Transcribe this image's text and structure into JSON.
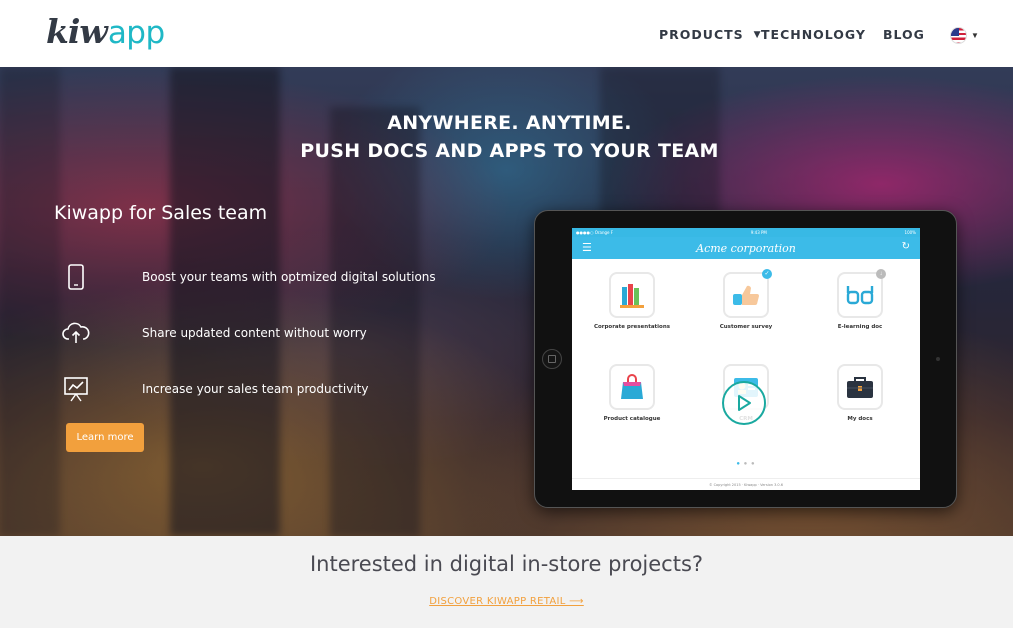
{
  "header": {
    "logo_part1": "kiw",
    "logo_part2": "app",
    "nav": {
      "products": "PRODUCTS",
      "technology": "TECHNOLOGY",
      "blog": "BLOG"
    },
    "language_icon": "us-flag-icon"
  },
  "hero": {
    "title_line1": "ANYWHERE. ANYTIME.",
    "title_line2": "PUSH DOCS AND APPS TO YOUR TEAM",
    "section_heading": "Kiwapp for Sales team",
    "features": [
      {
        "icon": "smartphone-icon",
        "text": "Boost your teams with optmized digital solutions"
      },
      {
        "icon": "cloud-upload-icon",
        "text": "Share updated content without worry"
      },
      {
        "icon": "presentation-chart-icon",
        "text": "Increase your sales team productivity"
      }
    ],
    "learn_more": "Learn more"
  },
  "tablet_app": {
    "status_left": "●●●●○ Orange F",
    "status_time": "9:43 PM",
    "status_right": "100%",
    "app_title": "Acme corporation",
    "tiles": [
      {
        "label": "Corporate presentations",
        "icon": "books-icon"
      },
      {
        "label": "Customer survey",
        "icon": "thumbs-up-icon"
      },
      {
        "label": "E-learning doc",
        "icon": "glasses-icon"
      },
      {
        "label": "Product catalogue",
        "icon": "shopping-bag-icon"
      },
      {
        "label": "CRM",
        "icon": "id-card-icon"
      },
      {
        "label": "My docs",
        "icon": "briefcase-icon"
      }
    ],
    "copyright": "© Copyright 2015 · Kiwapp · Version 3.0.6"
  },
  "band": {
    "title": "Interested in digital in-store projects?",
    "link": "DISCOVER KIWAPP RETAIL ⟶"
  },
  "colors": {
    "accent_orange": "#f2a03d",
    "brand_teal": "#1fb8c6",
    "app_blue": "#3cbbe8",
    "text_dark": "#333a45"
  }
}
